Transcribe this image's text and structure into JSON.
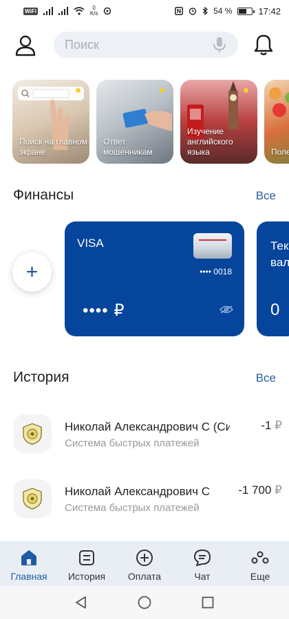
{
  "status_bar": {
    "wifi_badge": "WiFi",
    "net_speed_value": "0",
    "net_speed_unit": "K/s",
    "battery": "54 %",
    "time": "17:42"
  },
  "header": {
    "search_placeholder": "Поиск"
  },
  "stories": [
    {
      "caption": "Поиск на главном экране"
    },
    {
      "caption": "Ответ мошенникам"
    },
    {
      "caption": "Изучение английского языка"
    },
    {
      "caption": "Поле прод"
    }
  ],
  "finance": {
    "title": "Финансы",
    "all_label": "Все",
    "add_label": "+",
    "cards": [
      {
        "brand": "VISA",
        "number": "•••• 0018",
        "balance": "•••• ₽"
      },
      {
        "title": "Тек вал",
        "balance": "0"
      }
    ]
  },
  "history": {
    "title": "История",
    "all_label": "Все",
    "items": [
      {
        "name": "Николай Александрович С (Си",
        "subtitle": "Система быстрых платежей",
        "amount": "-1",
        "currency": "₽"
      },
      {
        "name": "Николай Александрович С",
        "subtitle": "Система быстрых платежей",
        "amount": "-1 700",
        "currency": "₽"
      }
    ]
  },
  "bottom_nav": [
    {
      "label": "Главная",
      "icon": "home-icon",
      "active": true
    },
    {
      "label": "История",
      "icon": "history-icon",
      "active": false
    },
    {
      "label": "Оплата",
      "icon": "payment-icon",
      "active": false
    },
    {
      "label": "Чат",
      "icon": "chat-icon",
      "active": false
    },
    {
      "label": "Еще",
      "icon": "more-icon",
      "active": false
    }
  ],
  "colors": {
    "brand_blue": "#05459b",
    "link_blue": "#2a5fa0",
    "story_dot": "#f4d22a"
  }
}
